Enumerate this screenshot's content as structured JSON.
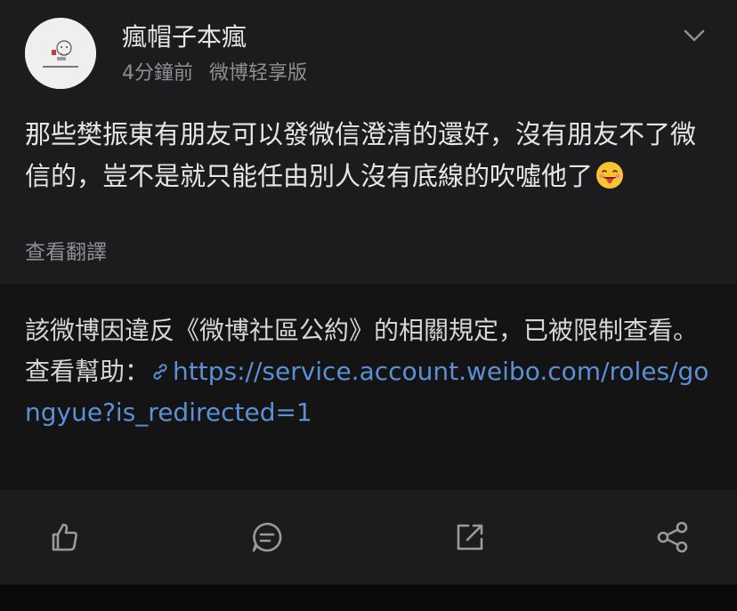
{
  "post": {
    "username": "瘋帽子本瘋",
    "time": "4分鐘前",
    "source": "微博轻享版",
    "text": "那些樊振東有朋友可以發微信澄清的還好，沒有朋友不了微信的，豈不是就只能任由別人沒有底線的吹噓他了",
    "emoji_icon": "tongue-face-emoji-icon",
    "translate_label": "查看翻譯"
  },
  "notice": {
    "text": "該微博因違反《微博社區公約》的相關規定，已被限制查看。查看幫助：",
    "link_text": "https://service.account.weibo.com/roles/gongyue?is_redirected=1",
    "link_color": "#5b8fd6"
  },
  "actions": {
    "icons": [
      "like-icon",
      "comment-icon",
      "repost-icon",
      "share-icon"
    ]
  },
  "colors": {
    "background": "#1c1c1e",
    "notice_background": "#141414",
    "text_primary": "#e6e6e6",
    "text_secondary": "#8e8e93",
    "link": "#5b8fd6"
  }
}
